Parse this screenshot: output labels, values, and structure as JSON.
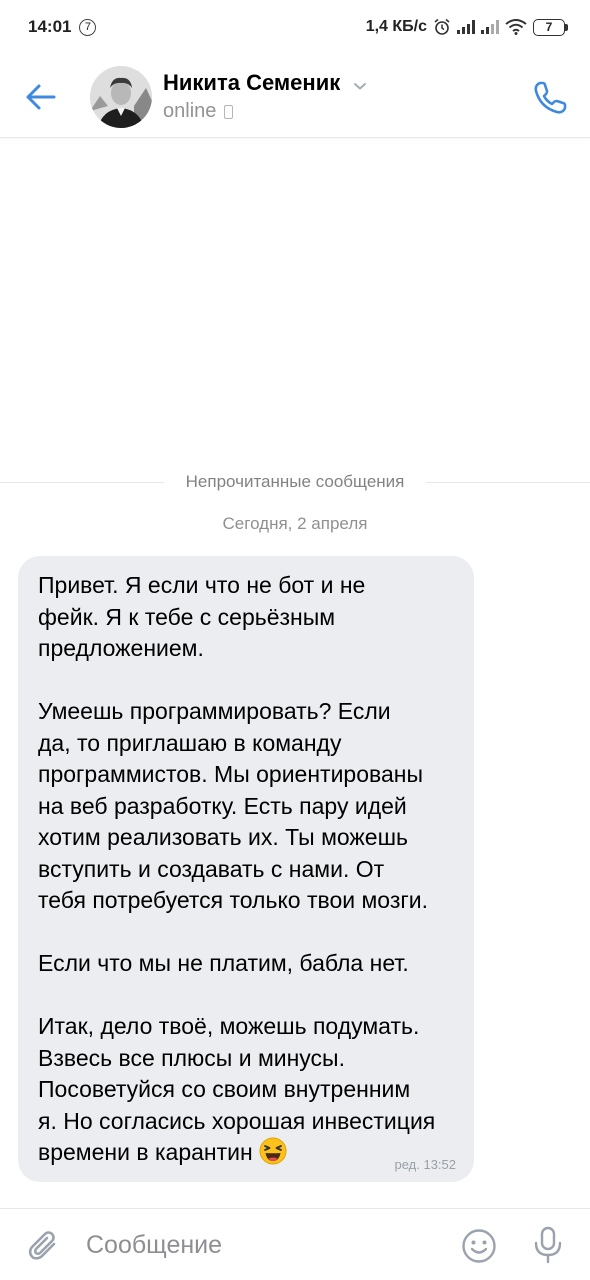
{
  "status_bar": {
    "time": "14:01",
    "notification_count": "7",
    "speed": "1,4 КБ/с",
    "battery": "7",
    "icons": [
      "alarm-icon",
      "signal-icon",
      "signal-icon",
      "wifi-icon",
      "battery-icon"
    ]
  },
  "header": {
    "contact_name": "Никита Семеник",
    "status": "online",
    "icons": [
      "back-arrow-icon",
      "chevron-down-icon",
      "mobile-icon",
      "phone-icon"
    ],
    "accent_color": "#3f8ae0"
  },
  "chat": {
    "unread_separator": "Непрочитанные сообщения",
    "date": "Сегодня, 2 апреля",
    "message": {
      "paragraphs": [
        "Привет. Я если что не бот и не\nфейк. Я к тебе с серьёзным\nпредложением.",
        "Умеешь программировать? Если\nда, то приглашаю в команду\nпрограммистов. Мы ориентированы\nна веб разработку. Есть пару идей\nхотим реализовать их. Ты можешь\nвступить и создавать с нами. От\nтебя потребуется только твои мозги.",
        "Если что мы не платим, бабла нет.",
        "Итак, дело твоё, можешь подумать.\nВзвесь все плюсы и минусы.\nПосоветуйся со своим внутренним\nя. Но согласись хорошая инвестиция\nвремени в карантин"
      ],
      "emoji": "laughing-face-emoji",
      "edited_label": "ред. 13:52",
      "bubble_color": "#ebedf0"
    }
  },
  "input_bar": {
    "placeholder": "Сообщение",
    "icons": [
      "paperclip-icon",
      "smile-icon",
      "microphone-icon"
    ]
  }
}
